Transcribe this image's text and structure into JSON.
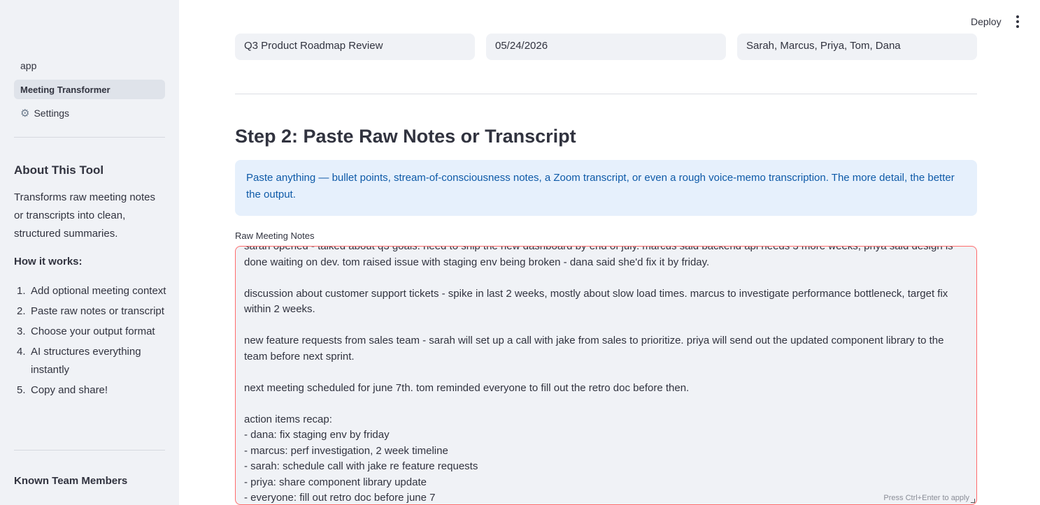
{
  "header": {
    "deploy_label": "Deploy"
  },
  "sidebar": {
    "nav": [
      {
        "label": "app"
      },
      {
        "label": "Meeting Transformer"
      },
      {
        "label": "Settings"
      }
    ],
    "about_heading": "About This Tool",
    "about_text": "Transforms raw meeting notes or transcripts into clean, structured summaries.",
    "how_heading": "How it works:",
    "steps": [
      "Add optional meeting context",
      "Paste raw notes or transcript",
      "Choose your output format",
      "AI structures everything instantly",
      "Copy and share!"
    ],
    "team_heading": "Known Team Members"
  },
  "context": {
    "meeting_title": "Q3 Product Roadmap Review",
    "meeting_date": "05/24/2026",
    "attendees": "Sarah, Marcus, Priya, Tom, Dana"
  },
  "step2": {
    "heading": "Step 2: Paste Raw Notes or Transcript",
    "info": "Paste anything — bullet points, stream-of-consciousness notes, a Zoom transcript, or even a rough voice-memo transcription. The more detail, the better the output.",
    "field_label": "Raw Meeting Notes",
    "notes": "sarah opened - talked about q3 goals. need to ship the new dashboard by end of july. marcus said backend api needs 3 more weeks, priya said design is done waiting on dev. tom raised issue with staging env being broken - dana said she'd fix it by friday.\n\ndiscussion about customer support tickets - spike in last 2 weeks, mostly about slow load times. marcus to investigate performance bottleneck, target fix within 2 weeks.\n\nnew feature requests from sales team - sarah will set up a call with jake from sales to prioritize. priya will send out the updated component library to the team before next sprint.\n\nnext meeting scheduled for june 7th. tom reminded everyone to fill out the retro doc before then.\n\naction items recap:\n- dana: fix staging env by friday\n- marcus: perf investigation, 2 week timeline\n- sarah: schedule call with jake re feature requests\n- priya: share component library update\n- everyone: fill out retro doc before june 7",
    "hint": "Press Ctrl+Enter to apply"
  }
}
